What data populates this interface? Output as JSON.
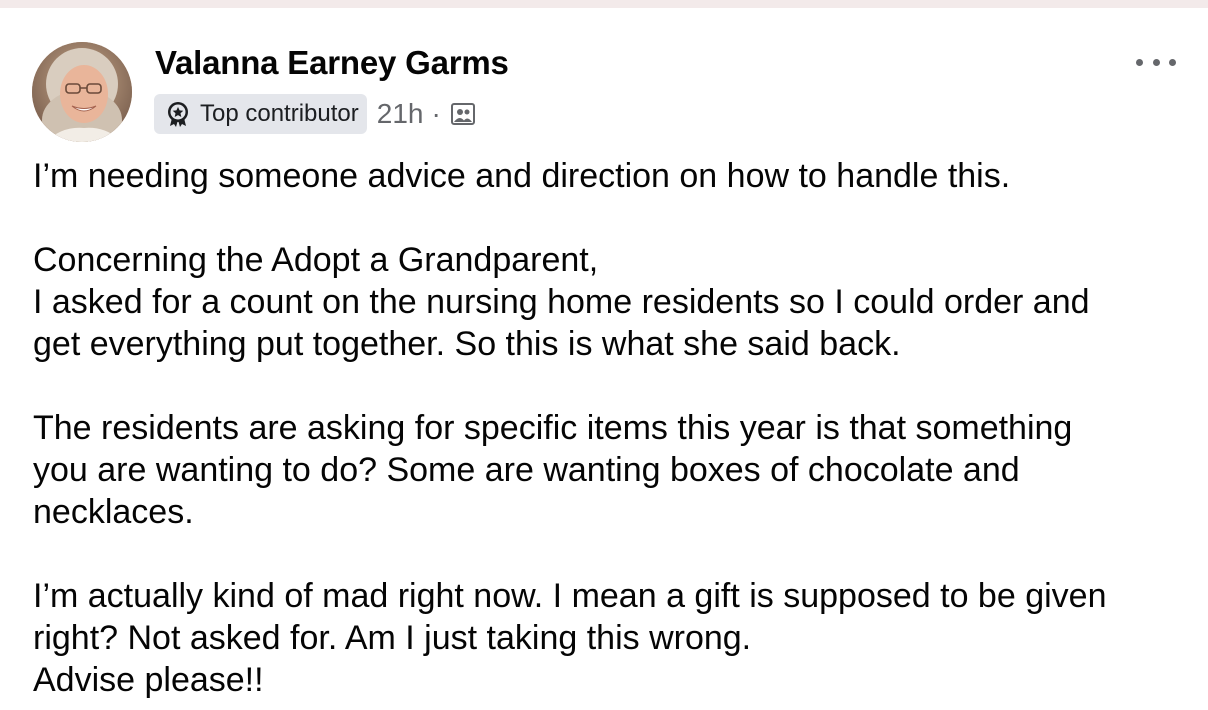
{
  "post": {
    "author": "Valanna Earney Garms",
    "badge_icon": "top-contributor-icon",
    "badge_label": "Top contributor",
    "time": "21h",
    "separator": "·",
    "audience_icon": "group-audience-icon",
    "more_icon": "more-options-icon",
    "paragraphs": [
      [
        "I’m needing someone advice and direction on how to handle this."
      ],
      [
        "Concerning the Adopt a Grandparent,",
        "I asked for a count on the nursing home residents so I could order and",
        "get everything put together. So this is what she said back."
      ],
      [
        "The residents are asking for specific items this year is that something",
        "you are wanting to do? Some are wanting boxes of chocolate and",
        "necklaces."
      ],
      [
        "I’m actually kind of mad right now. I mean a gift is supposed to be given",
        "right? Not asked for. Am I just taking this wrong.",
        "Advise please!!"
      ]
    ]
  },
  "colors": {
    "secondary_text": "#65676b",
    "badge_bg": "#e4e6eb",
    "top_strip": "#f3eaea"
  }
}
